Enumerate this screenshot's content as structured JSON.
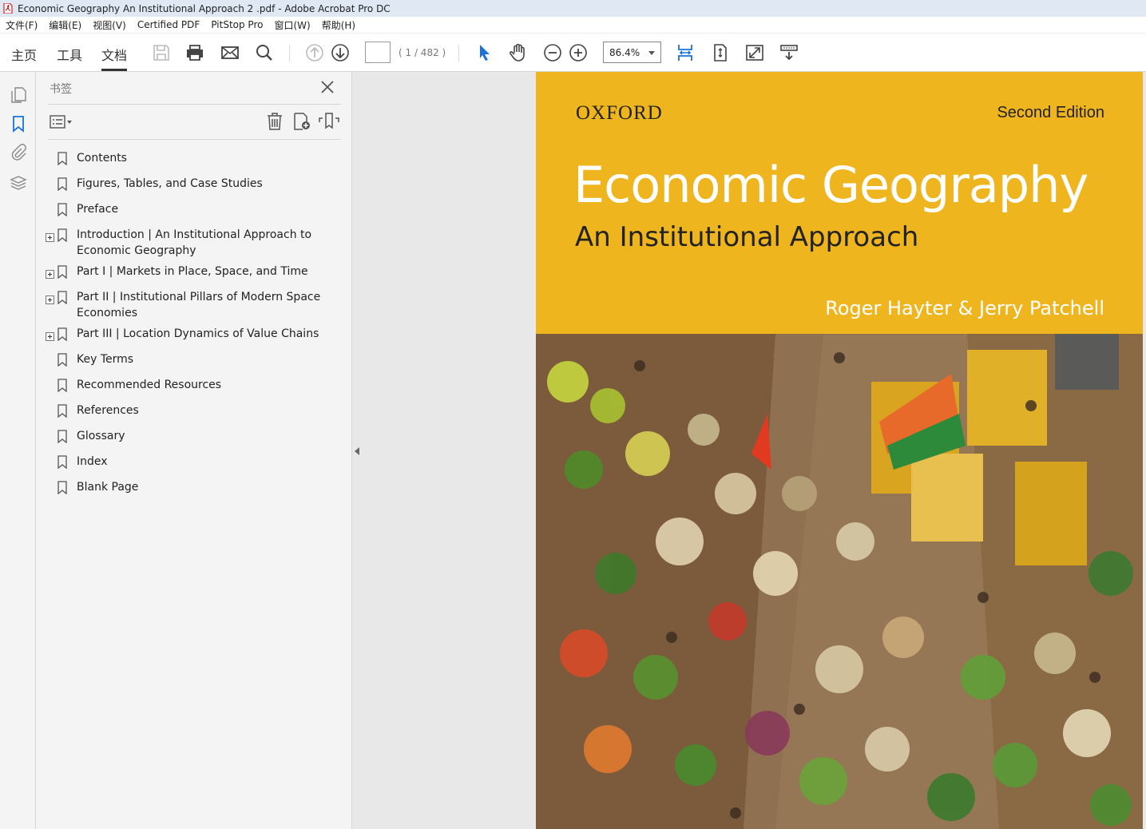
{
  "window": {
    "title": "Economic Geography An Institutional Approach 2 .pdf - Adobe Acrobat Pro DC"
  },
  "menubar": {
    "items": [
      "文件(F)",
      "编辑(E)",
      "视图(V)",
      "Certified PDF",
      "PitStop Pro",
      "窗口(W)",
      "帮助(H)"
    ]
  },
  "toolbar": {
    "tabs": [
      "主页",
      "工具",
      "文档"
    ],
    "active_tab": "文档",
    "page_current": "",
    "page_count": "( 1 / 482 )",
    "zoom": "86.4%"
  },
  "panel": {
    "title": "书签",
    "bookmarks": [
      {
        "label": "Contents",
        "expandable": false
      },
      {
        "label": "Figures, Tables, and Case Studies",
        "expandable": false
      },
      {
        "label": "Preface",
        "expandable": false
      },
      {
        "label": "Introduction | An Institutional Approach to Economic Geography",
        "expandable": true
      },
      {
        "label": "Part I | Markets in Place, Space, and Time",
        "expandable": true
      },
      {
        "label": "Part II | Institutional Pillars of Modern Space Economies",
        "expandable": true
      },
      {
        "label": "Part III | Location Dynamics of Value Chains",
        "expandable": true
      },
      {
        "label": "Key Terms",
        "expandable": false
      },
      {
        "label": "Recommended Resources",
        "expandable": false
      },
      {
        "label": "References",
        "expandable": false
      },
      {
        "label": "Glossary",
        "expandable": false
      },
      {
        "label": "Index",
        "expandable": false
      },
      {
        "label": "Blank Page",
        "expandable": false
      }
    ]
  },
  "cover": {
    "publisher": "OXFORD",
    "edition": "Second Edition",
    "title": "Economic Geography",
    "subtitle": "An Institutional Approach",
    "authors": "Roger Hayter & Jerry Patchell",
    "accent_color": "#efb51f"
  }
}
